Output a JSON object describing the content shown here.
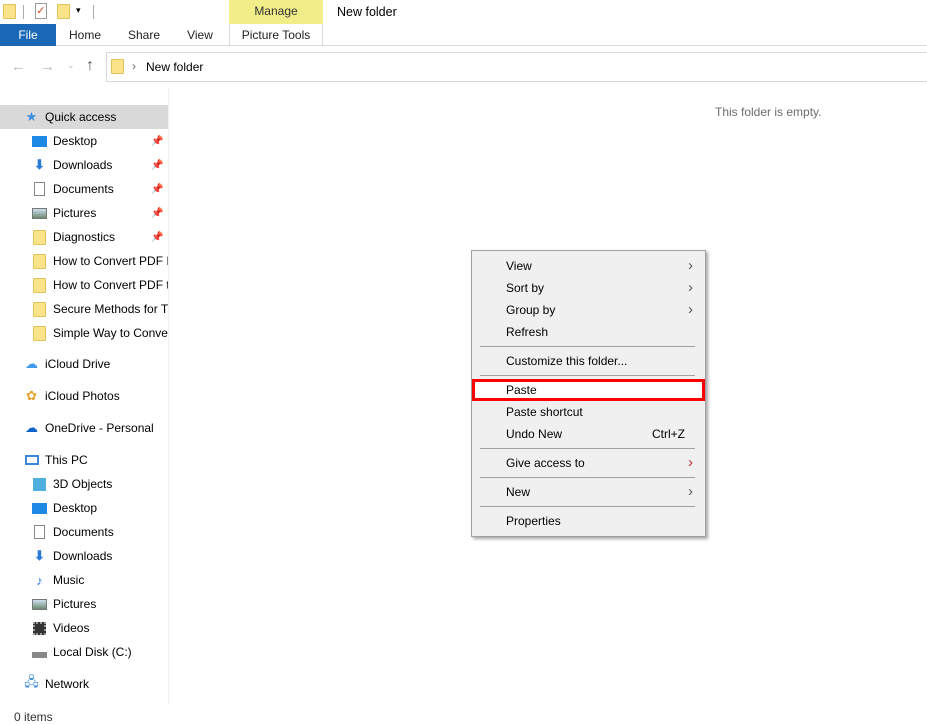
{
  "title": "New folder",
  "ribbon": {
    "manage": "Manage",
    "tabs": [
      "File",
      "Home",
      "Share",
      "View",
      "Picture Tools"
    ]
  },
  "address": {
    "path": "New folder"
  },
  "nav": {
    "quick_access": "Quick access",
    "quick_items": [
      {
        "label": "Desktop",
        "icon": "desktop-icon",
        "pinned": true
      },
      {
        "label": "Downloads",
        "icon": "download-icon",
        "pinned": true
      },
      {
        "label": "Documents",
        "icon": "document-icon",
        "pinned": true
      },
      {
        "label": "Pictures",
        "icon": "pictures-icon",
        "pinned": true
      },
      {
        "label": "Diagnostics",
        "icon": "folder-icon",
        "pinned": true
      },
      {
        "label": "How to Convert PDF I",
        "icon": "folder-icon"
      },
      {
        "label": "How to Convert PDF t",
        "icon": "folder-icon"
      },
      {
        "label": "Secure Methods for Tr",
        "icon": "folder-icon"
      },
      {
        "label": "Simple Way to Conve",
        "icon": "folder-icon"
      }
    ],
    "icloud_drive": "iCloud Drive",
    "icloud_photos": "iCloud Photos",
    "onedrive": "OneDrive - Personal",
    "this_pc": "This PC",
    "pc_items": [
      {
        "label": "3D Objects",
        "icon": "cube-icon"
      },
      {
        "label": "Desktop",
        "icon": "desktop-icon"
      },
      {
        "label": "Documents",
        "icon": "document-icon"
      },
      {
        "label": "Downloads",
        "icon": "download-icon"
      },
      {
        "label": "Music",
        "icon": "music-icon"
      },
      {
        "label": "Pictures",
        "icon": "pictures-icon"
      },
      {
        "label": "Videos",
        "icon": "video-icon"
      },
      {
        "label": "Local Disk (C:)",
        "icon": "disk-icon"
      }
    ],
    "network": "Network"
  },
  "content": {
    "empty": "This folder is empty."
  },
  "status": "0 items",
  "menu": {
    "view": "View",
    "sort_by": "Sort by",
    "group_by": "Group by",
    "refresh": "Refresh",
    "customize": "Customize this folder...",
    "paste": "Paste",
    "paste_shortcut": "Paste shortcut",
    "undo_new": "Undo New",
    "undo_shortcut": "Ctrl+Z",
    "give_access": "Give access to",
    "new": "New",
    "properties": "Properties"
  },
  "colors": {
    "file_tab": "#1a68b6",
    "manage_tab": "#f1ee8a",
    "highlight": "#ff0000"
  }
}
